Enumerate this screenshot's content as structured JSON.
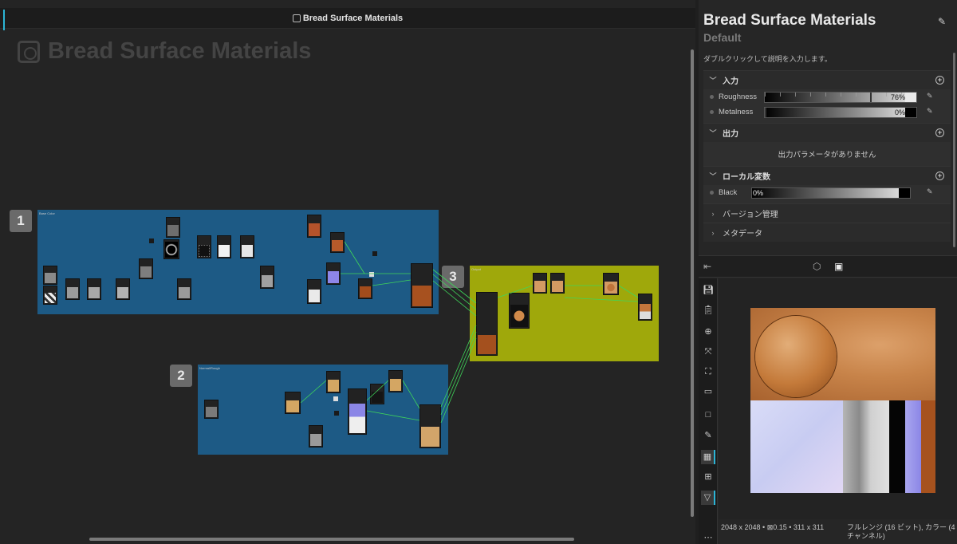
{
  "graph": {
    "tab_title": "Bread Surface Materials",
    "canvas_title": "Bread Surface Materials",
    "frames": [
      {
        "number": "1",
        "color": "#1d5a85",
        "label": "Base Color"
      },
      {
        "number": "2",
        "color": "#1d5a85",
        "label": "Normal/Rough"
      },
      {
        "number": "3",
        "color": "#9fa80b",
        "label": "Output"
      }
    ]
  },
  "panel": {
    "title": "Bread Surface Materials",
    "subtitle": "Default",
    "description_hint": "ダブルクリックして説明を入力します。",
    "sections": {
      "inputs": {
        "label": "入力",
        "params": [
          {
            "name": "Roughness",
            "value_text": "76%",
            "value": 0.76
          },
          {
            "name": "Metalness",
            "value_text": "0%",
            "value": 0.0
          }
        ]
      },
      "outputs": {
        "label": "出力",
        "empty_message": "出力パラメータがありません"
      },
      "locals": {
        "label": "ローカル変数",
        "params": [
          {
            "name": "Black",
            "value_text": "0%",
            "value": 0.0
          }
        ]
      },
      "version": {
        "label": "バージョン管理"
      },
      "metadata": {
        "label": "メタデータ"
      }
    }
  },
  "viewer": {
    "tabs": [
      "back-icon",
      "cube-icon",
      "image-icon"
    ],
    "tools": [
      "save-icon",
      "clipboard-icon",
      "target-icon",
      "fit-icon",
      "frame-icon",
      "ruler-icon",
      "square-icon",
      "pen-icon",
      "checker-icon",
      "grid-icon",
      "filter-icon"
    ],
    "status_left": "2048 x 2048 • ⊠0.15 • 311 x 311",
    "status_right": "フルレンジ (16 ビット), カラー (4 チャンネル)"
  },
  "colors": {
    "accent": "#2cb5d6",
    "frame_blue": "#1d5a85",
    "frame_olive": "#9fa80b",
    "wire_green": "#3fd65a"
  }
}
